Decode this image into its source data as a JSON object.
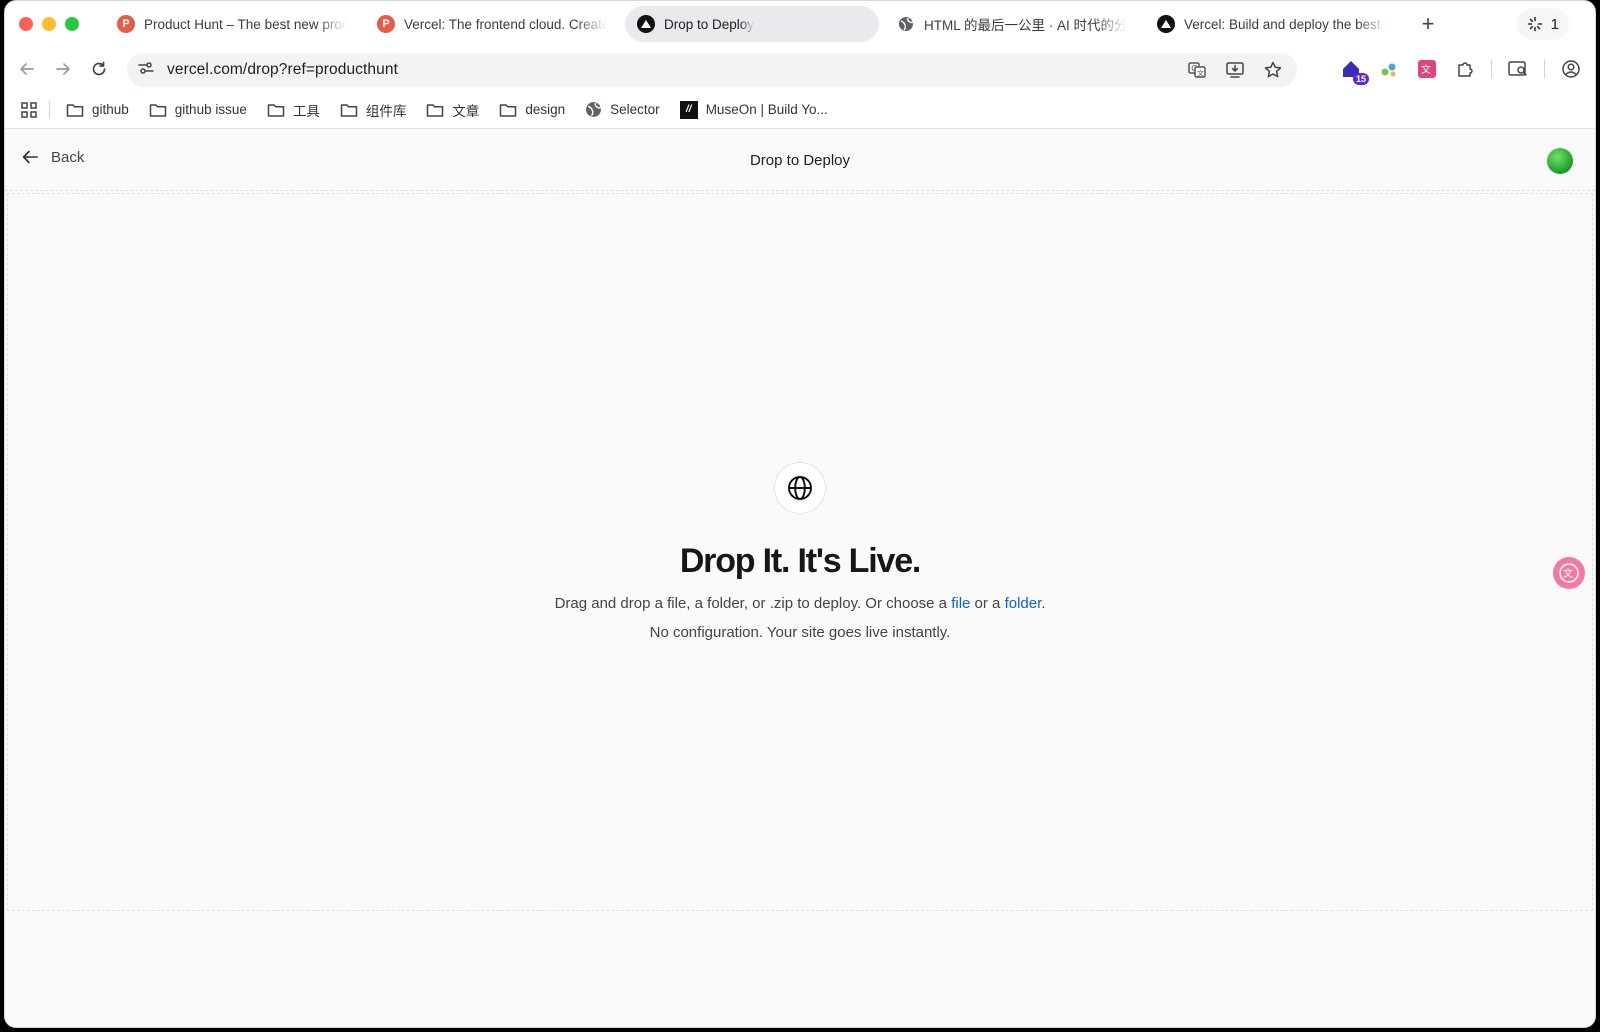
{
  "tabs": [
    {
      "title": "Product Hunt – The best new products in tech.",
      "favicon": "product-hunt-icon",
      "active": false
    },
    {
      "title": "Vercel: The frontend cloud. Create at the moment of inspiration.",
      "favicon": "product-hunt-icon",
      "active": false
    },
    {
      "title": "Drop to Deploy",
      "favicon": "vercel-icon",
      "active": true
    },
    {
      "title": "HTML 的最后一公里 · AI 时代的分享",
      "favicon": "globe-icon",
      "active": false
    },
    {
      "title": "Vercel: Build and deploy the best web experiences",
      "favicon": "vercel-icon",
      "active": false
    }
  ],
  "tabstrip": {
    "new_tab": "+",
    "counter": "1"
  },
  "omnibox": {
    "url": "vercel.com/drop?ref=producthunt"
  },
  "extensions": {
    "badge_count": "15"
  },
  "bookmarks": [
    {
      "label": "github",
      "icon": "folder-icon"
    },
    {
      "label": "github issue",
      "icon": "folder-icon"
    },
    {
      "label": "工具",
      "icon": "folder-icon"
    },
    {
      "label": "组件库",
      "icon": "folder-icon"
    },
    {
      "label": "文章",
      "icon": "folder-icon"
    },
    {
      "label": "design",
      "icon": "folder-icon"
    },
    {
      "label": "Selector",
      "icon": "globe-icon"
    },
    {
      "label": "MuseOn | Build Yo...",
      "icon": "museon-icon"
    }
  ],
  "page": {
    "back_label": "Back",
    "title": "Drop to Deploy",
    "headline": "Drop It. It's Live.",
    "sub_prefix": "Drag and drop a file, a folder, or .zip to deploy. Or choose a ",
    "file_link": "file",
    "sub_middle": " or a ",
    "folder_link": "folder",
    "sub_suffix": ".",
    "sub2": "No configuration. Your site goes live instantly."
  },
  "colors": {
    "link": "#0a63d0",
    "active_tab": "#e9eaed",
    "badge": "#5b2bd6"
  }
}
